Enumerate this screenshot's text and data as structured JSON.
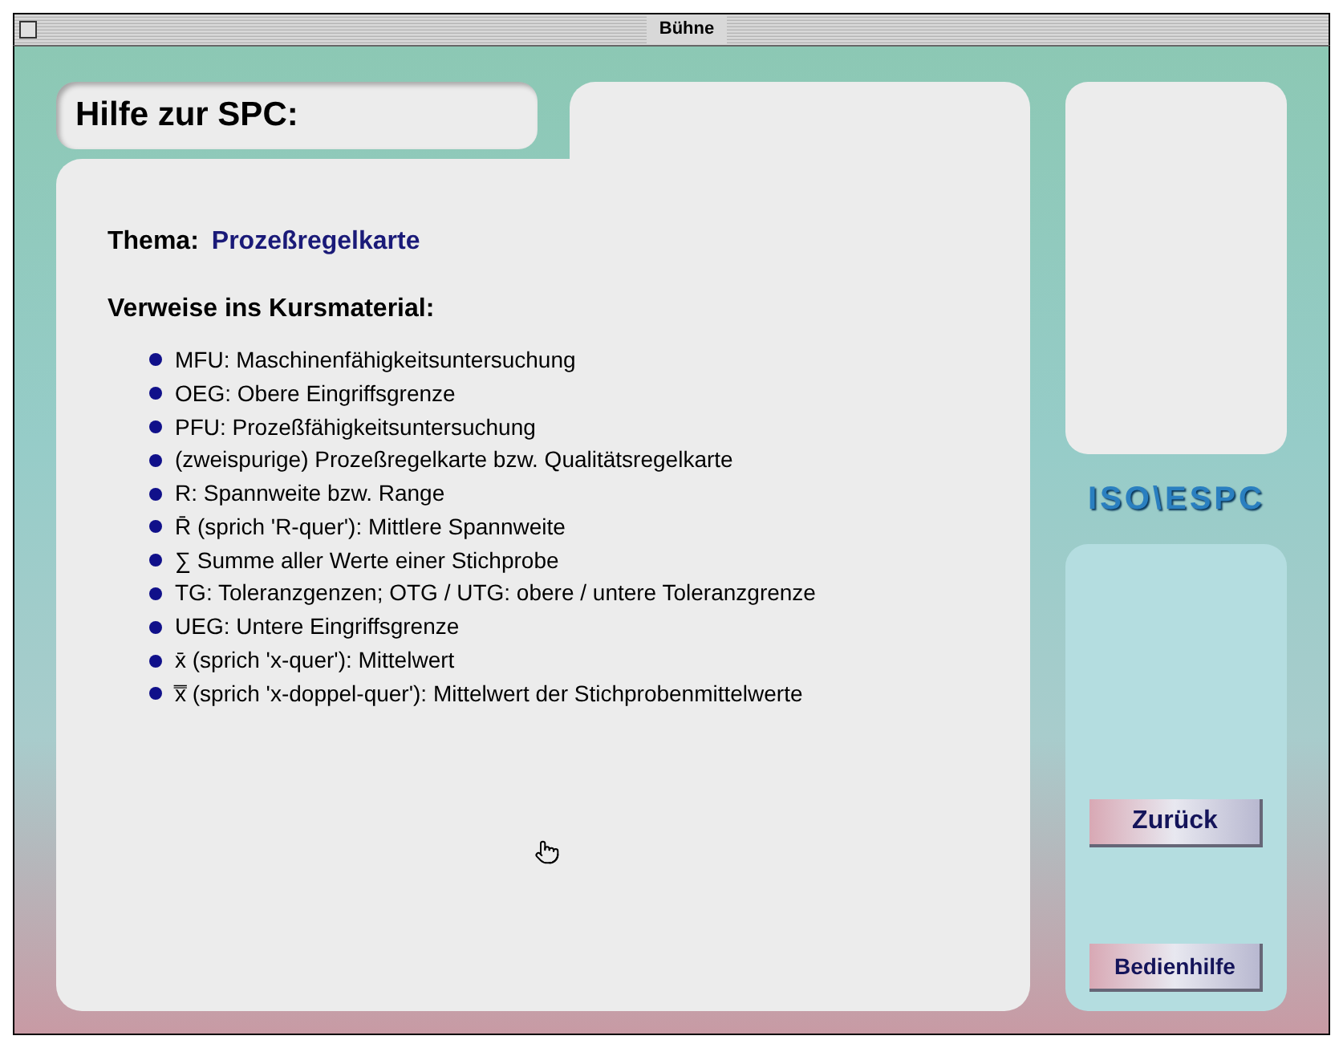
{
  "window": {
    "title": "Bühne"
  },
  "header": {
    "title": "Hilfe zur SPC:"
  },
  "topic": {
    "label": "Thema:",
    "value": "Prozeßregelkarte"
  },
  "references": {
    "heading": "Verweise ins Kursmaterial:",
    "items": [
      "MFU: Maschinenfähigkeitsuntersuchung",
      "OEG: Obere Eingriffsgrenze",
      "PFU: Prozeßfähigkeitsuntersuchung",
      "(zweispurige) Prozeßregelkarte bzw. Qualitätsregelkarte",
      "R: Spannweite bzw. Range",
      "R̄ (sprich 'R-quer'): Mittlere Spannweite",
      "∑  Summe aller Werte einer Stichprobe",
      "TG: Toleranzgenzen; OTG / UTG: obere / untere Toleranzgrenze",
      "UEG: Untere Eingriffsgrenze",
      "x̄ (sprich 'x-quer'): Mittelwert",
      "x̿ (sprich 'x-doppel-quer'): Mittelwert der Stichprobenmittelwerte"
    ]
  },
  "logo": "ISO\\ESPC",
  "buttons": [
    "Zurück",
    "Bedienhilfe"
  ]
}
